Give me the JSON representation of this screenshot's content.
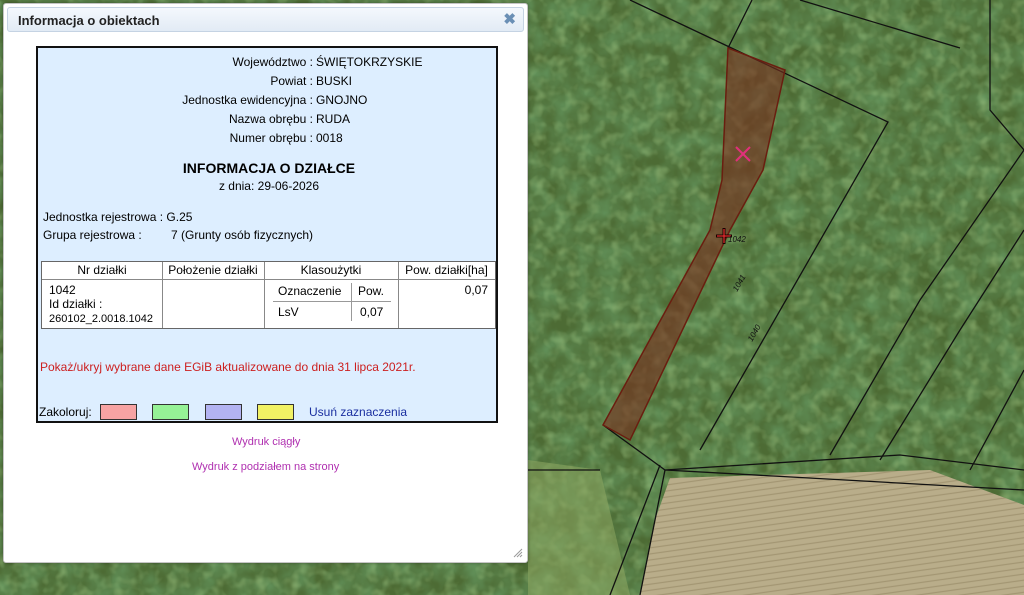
{
  "dialog": {
    "title": "Informacja o obiektach",
    "close_glyph": "✖"
  },
  "location": {
    "wojewodztwo_label": "Województwo :",
    "wojewodztwo": "ŚWIĘTOKRZYSKIE",
    "powiat_label": "Powiat :",
    "powiat": "BUSKI",
    "jednostka_label": "Jednostka ewidencyjna :",
    "jednostka": "GNOJNO",
    "nazwa_obrebu_label": "Nazwa obrębu :",
    "nazwa_obrebu": "RUDA",
    "numer_obrebu_label": "Numer obrębu :",
    "numer_obrebu": "0018"
  },
  "parcel_info": {
    "heading": "INFORMACJA O DZIAŁCE",
    "date": "z dnia: 29-06-2026",
    "jednostka_rejestrowa_label": "Jednostka rejestrowa :",
    "jednostka_rejestrowa": "G.25",
    "grupa_rejestrowa_label": "Grupa rejestrowa :",
    "grupa_rejestrowa": "7 (Grunty osób fizycznych)"
  },
  "table": {
    "headers": [
      "Nr działki",
      "Położenie działki",
      "Klasoużytki",
      "Pow. działki[ha]"
    ],
    "sub_headers": [
      "Oznaczenie",
      "Pow."
    ],
    "nr_dzialki": "1042",
    "id_label": "Id działki :",
    "id_value": "260102_2.0018.1042",
    "oznaczenie": "LsV",
    "pow_klasouzytku": "0,07",
    "pow_dzialki": "0,07"
  },
  "links": {
    "show_hide": "Pokaż/ukryj wybrane dane EGiB aktualizowane do dnia 31 lipca 2021r.",
    "colorize_label": "Zakoloruj:",
    "clear_selection": "Usuń zaznaczenia",
    "print_continuous": "Wydruk ciągły",
    "print_paged": "Wydruk z podziałem na strony"
  },
  "swatch_colors": [
    "#f7a3a3",
    "#96f296",
    "#b3b3f2",
    "#f2f264"
  ],
  "map": {
    "parcel_labels": [
      "1042",
      "1041",
      "1040"
    ]
  }
}
